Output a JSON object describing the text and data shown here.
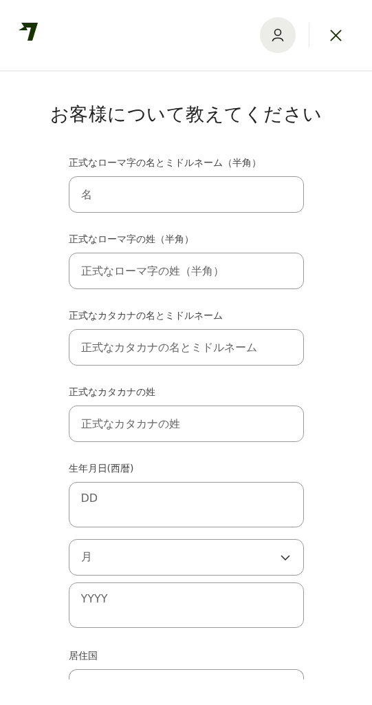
{
  "title": "お客様について教えてください",
  "fields": [
    {
      "kind": "text",
      "label": "正式なローマ字の名とミドルネーム（半角）",
      "placeholder": "名"
    },
    {
      "kind": "text",
      "label": "正式なローマ字の姓（半角）",
      "placeholder": "正式なローマ字の姓（半角）"
    },
    {
      "kind": "text",
      "label": "正式なカタカナの名とミドルネーム",
      "placeholder": "正式なカタカナの名とミドルネーム"
    },
    {
      "kind": "text",
      "label": "正式なカタカナの姓",
      "placeholder": "正式なカタカナの姓"
    },
    {
      "kind": "date",
      "label": "生年月日(西暦)",
      "day_placeholder": "DD",
      "month_placeholder": "月",
      "year_placeholder": "YYYY"
    },
    {
      "kind": "select_cut",
      "label": "居住国"
    }
  ]
}
